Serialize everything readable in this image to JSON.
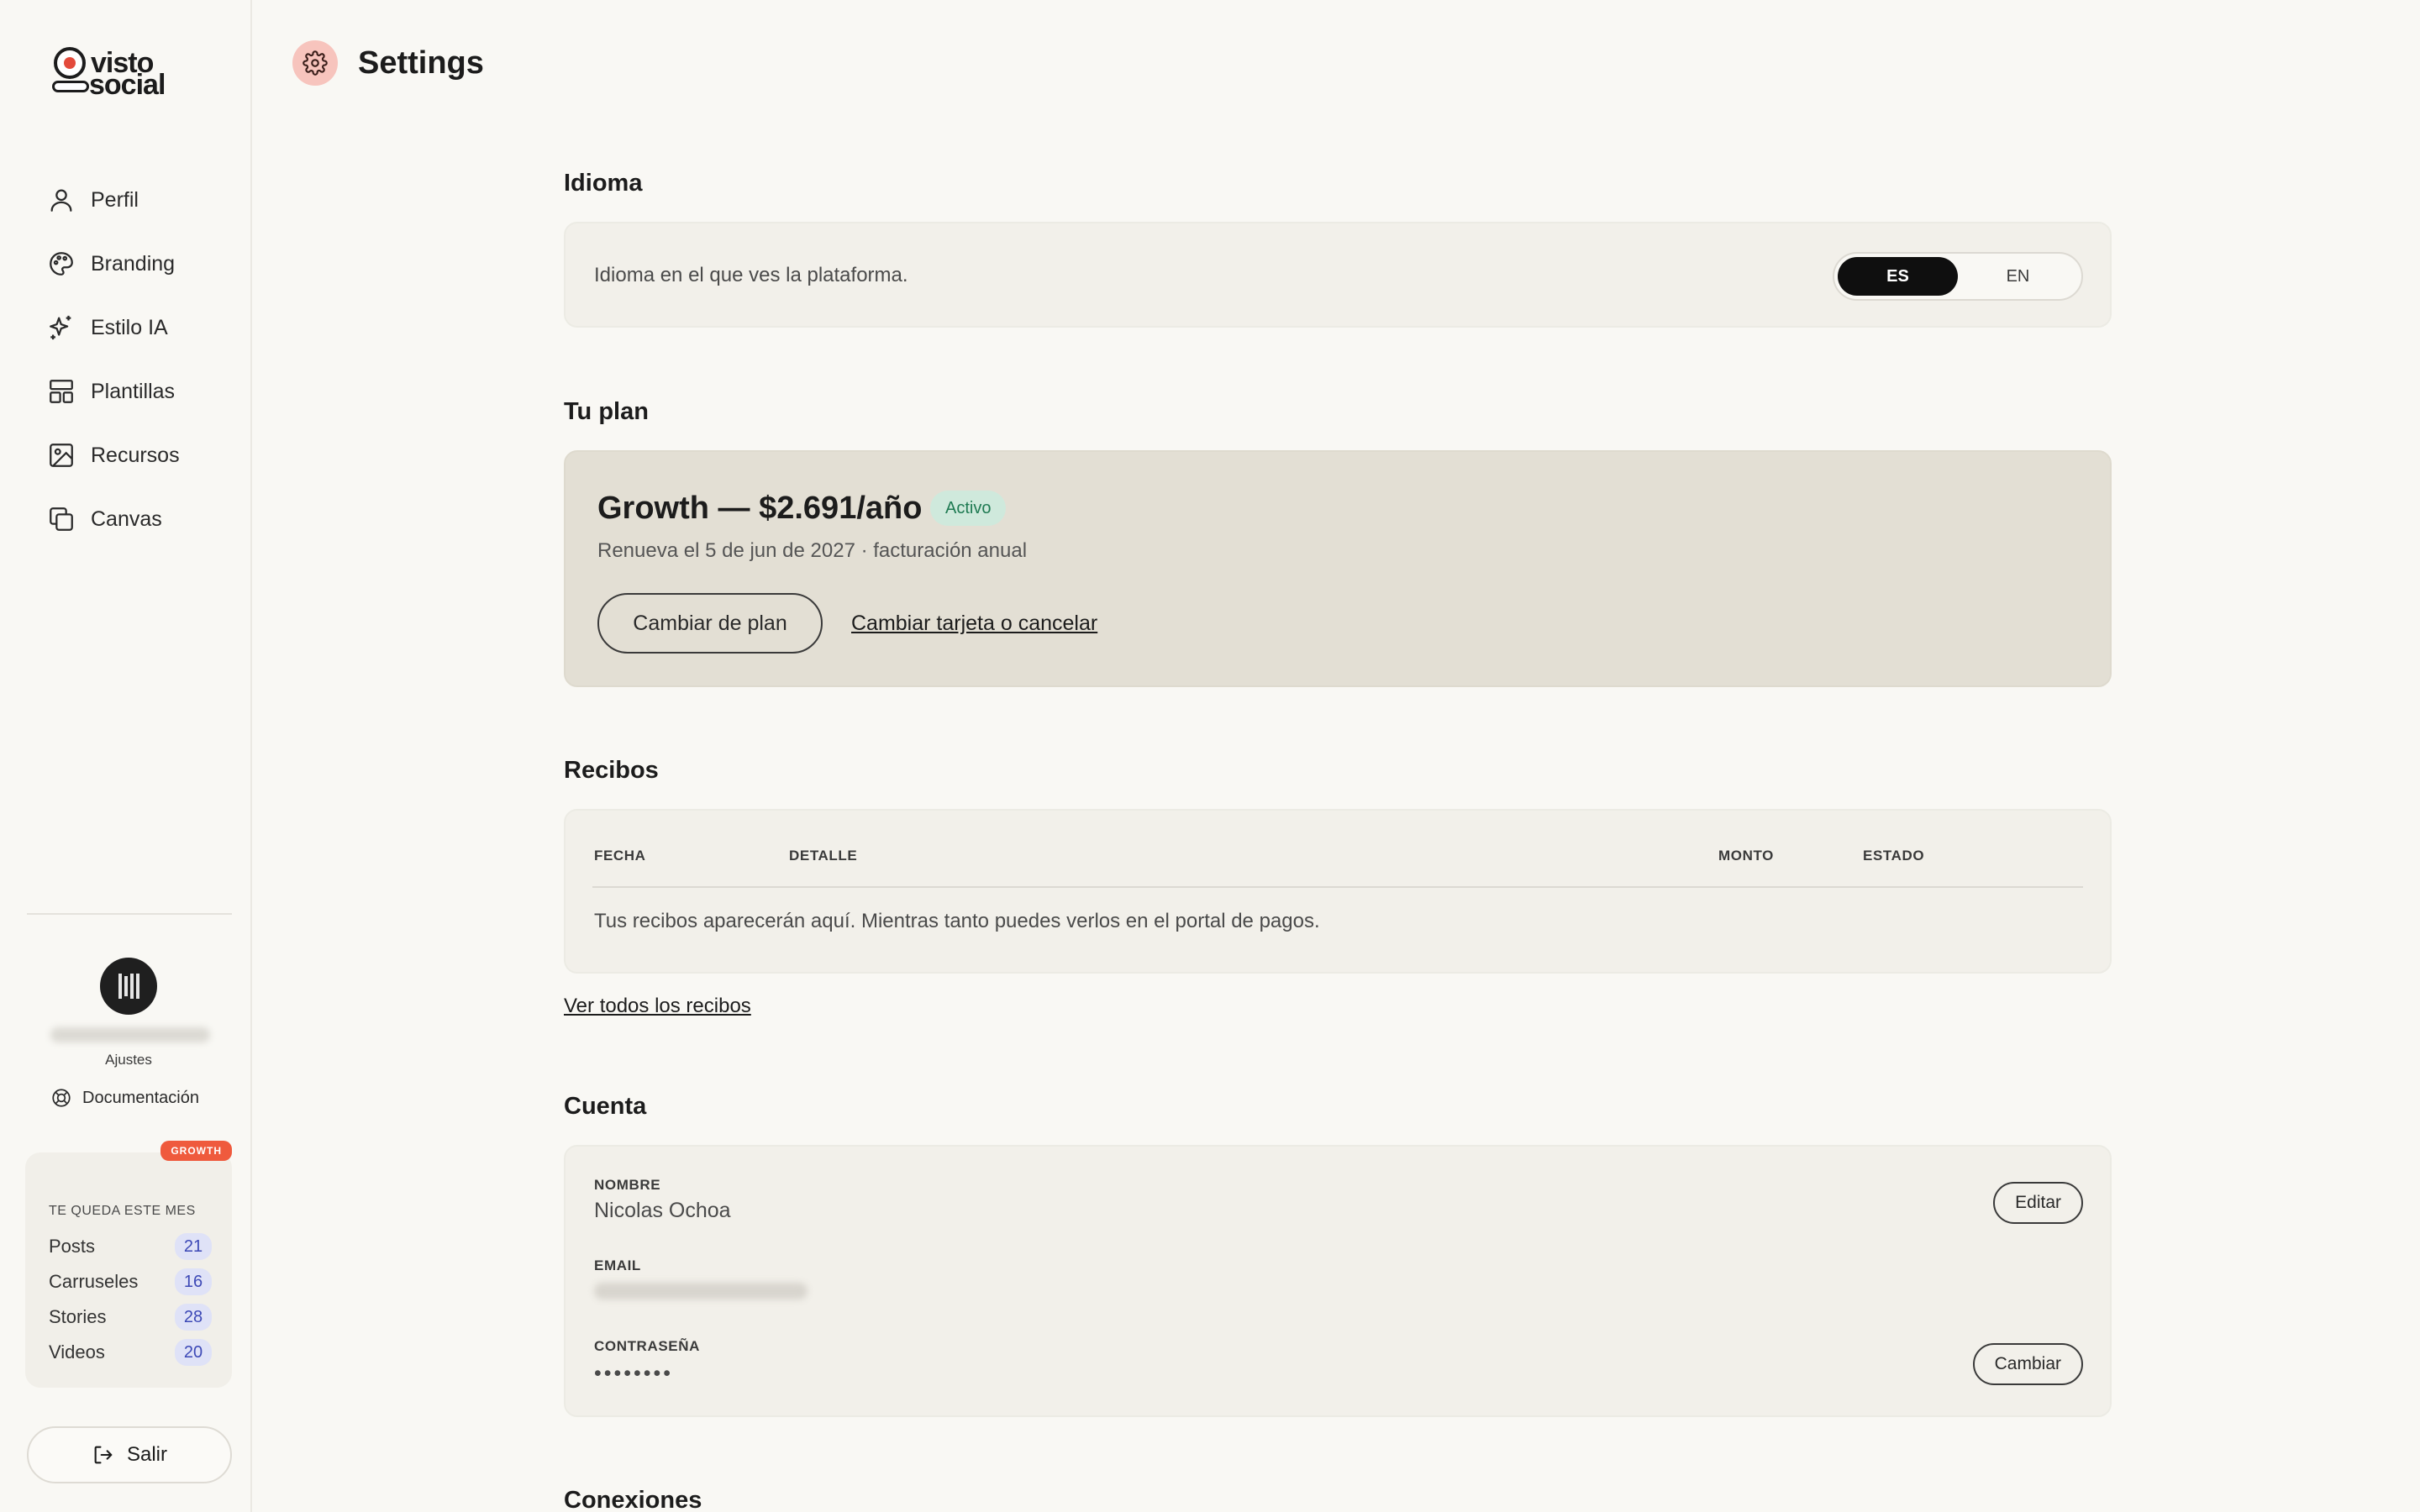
{
  "brand": {
    "logo_line1": "visto",
    "logo_line2": "social"
  },
  "sidebar": {
    "items": [
      {
        "label": "Perfil",
        "icon": "user-icon"
      },
      {
        "label": "Branding",
        "icon": "palette-icon"
      },
      {
        "label": "Estilo IA",
        "icon": "sparkles-icon"
      },
      {
        "label": "Plantillas",
        "icon": "layout-icon"
      },
      {
        "label": "Recursos",
        "icon": "image-icon"
      },
      {
        "label": "Canvas",
        "icon": "copy-icon"
      }
    ],
    "settings_label": "Ajustes",
    "docs_label": "Documentación",
    "usage": {
      "badge": "GROWTH",
      "title": "TE QUEDA ESTE MES",
      "rows": [
        {
          "name": "Posts",
          "count": "21"
        },
        {
          "name": "Carruseles",
          "count": "16"
        },
        {
          "name": "Stories",
          "count": "28"
        },
        {
          "name": "Videos",
          "count": "20"
        }
      ]
    },
    "logout_label": "Salir"
  },
  "header": {
    "title": "Settings"
  },
  "language": {
    "title": "Idioma",
    "description": "Idioma en el que ves la plataforma.",
    "options": [
      "ES",
      "EN"
    ],
    "selected": "ES"
  },
  "plan": {
    "title": "Tu plan",
    "name": "Growth — $2.691/año",
    "status": "Activo",
    "renewal": "Renueva el 5 de jun de 2027 · facturación anual",
    "change_button": "Cambiar de plan",
    "manage_link": "Cambiar tarjeta o cancelar"
  },
  "receipts": {
    "title": "Recibos",
    "columns": [
      "FECHA",
      "DETALLE",
      "MONTO",
      "ESTADO"
    ],
    "empty_message": "Tus recibos aparecerán aquí. Mientras tanto puedes verlos en el portal de pagos.",
    "view_all_link": "Ver todos los recibos"
  },
  "account": {
    "title": "Cuenta",
    "name_label": "NOMBRE",
    "name_value": "Nicolas Ochoa",
    "edit_button": "Editar",
    "email_label": "EMAIL",
    "password_label": "CONTRASEÑA",
    "password_value": "••••••••",
    "change_button": "Cambiar"
  },
  "connections": {
    "title": "Conexiones"
  },
  "colors": {
    "background": "#f9f8f4",
    "accent_badge": "#ef5a3d",
    "active_badge": "#cfe9dc",
    "usage_chip": "#dfe2f7"
  }
}
